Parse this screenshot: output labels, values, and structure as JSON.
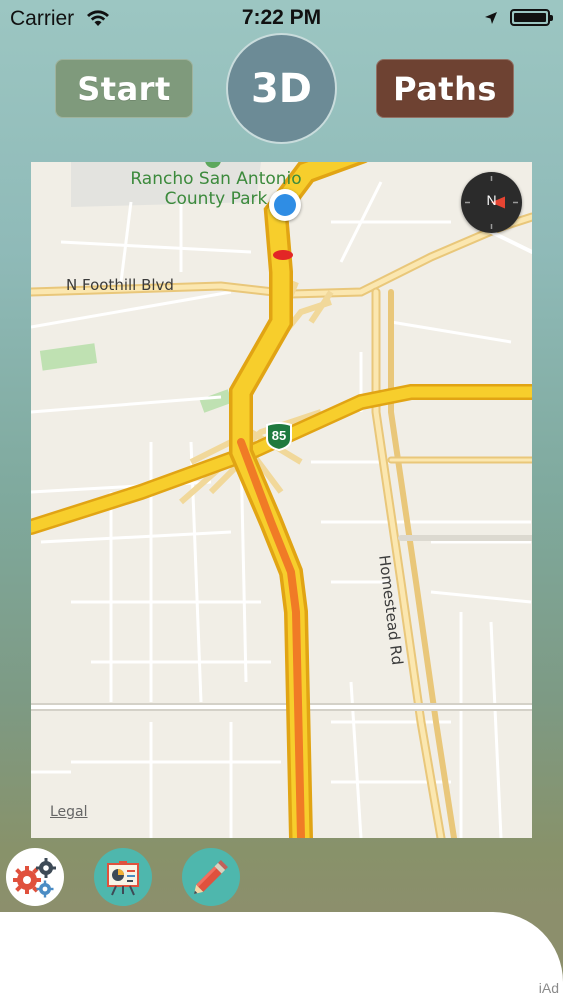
{
  "status_bar": {
    "carrier": "Carrier",
    "time": "7:22 PM",
    "icons": [
      "wifi-icon",
      "location-arrow-icon",
      "battery-icon"
    ]
  },
  "header": {
    "start_label": "Start",
    "mode_label": "3D",
    "paths_label": "Paths"
  },
  "map": {
    "park_name": "Rancho San Antonio County Park",
    "road_foothill": "N Foothill Blvd",
    "road_homestead": "Homestead Rd",
    "route_shield": "85",
    "legal_link": "Legal",
    "compass_heading": "N"
  },
  "toolbar": {
    "items": [
      {
        "icon": "gears-icon",
        "label": "Settings"
      },
      {
        "icon": "presentation-chart-icon",
        "label": "Statistics"
      },
      {
        "icon": "pencil-icon",
        "label": "Edit"
      }
    ]
  },
  "ad_banner": {
    "badge": "iAd"
  },
  "colors": {
    "start_button": "#7f9a7c",
    "mode_button": "#6c8b96",
    "paths_button": "#6e4232",
    "tool_teal": "#4eb7ad",
    "freeway_yellow": "#f5c419",
    "freeway_orange": "#f07b26",
    "user_location": "#2f8de4"
  }
}
